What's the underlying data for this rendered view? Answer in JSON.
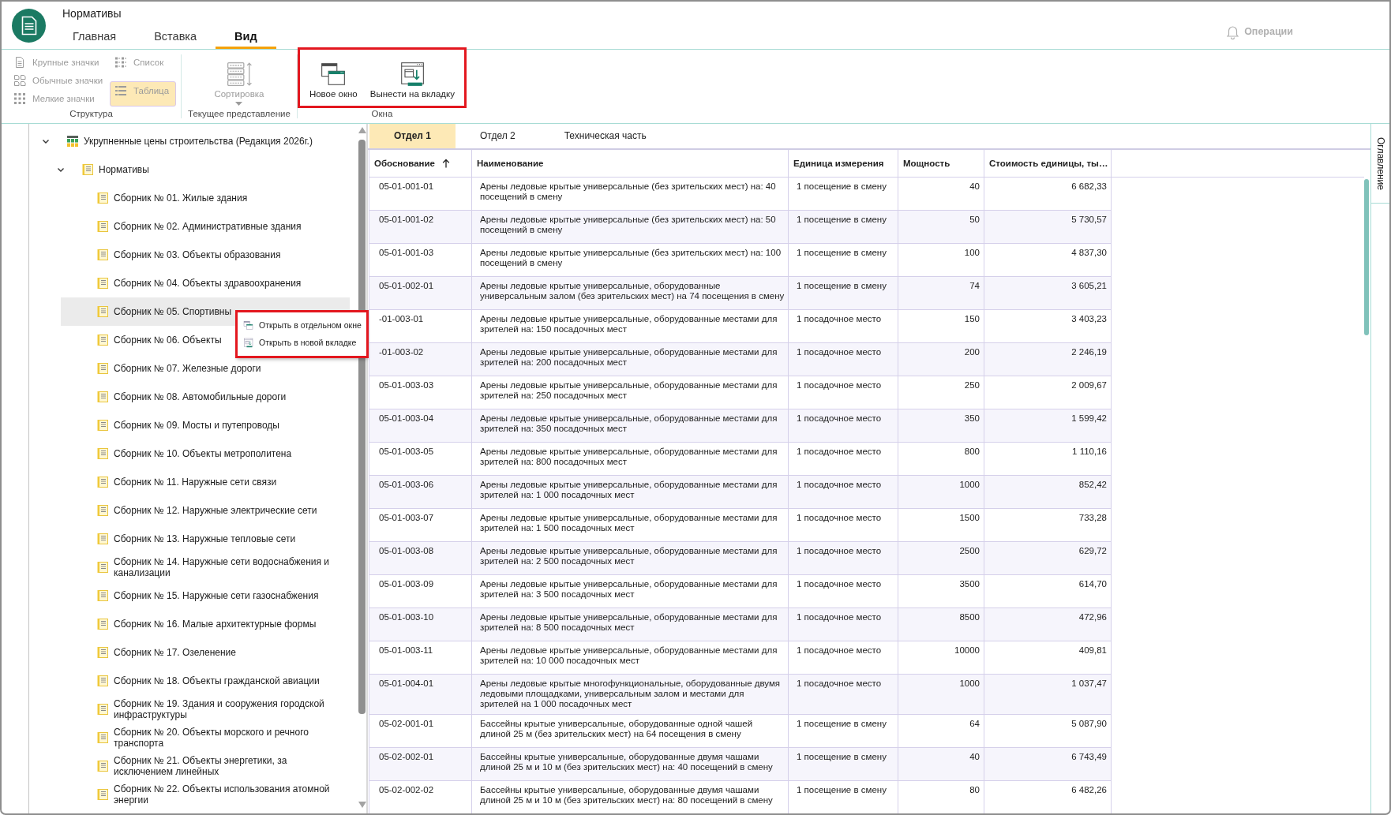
{
  "app": {
    "title": "Нормативы"
  },
  "ribbon_tabs": [
    {
      "label": "Главная",
      "selected": false
    },
    {
      "label": "Вставка",
      "selected": false
    },
    {
      "label": "Вид",
      "selected": true
    }
  ],
  "notifications": {
    "label": "Операции",
    "disabled": true
  },
  "ribbon": [
    {
      "label": "Структура",
      "kind": "small",
      "items": [
        {
          "label": "Крупные значки",
          "selected": false,
          "disabled": true
        },
        {
          "label": "Обычные значки",
          "selected": false,
          "disabled": true
        },
        {
          "label": "Мелкие значки",
          "selected": false,
          "disabled": true
        },
        {
          "label": "Список",
          "selected": false,
          "disabled": true
        },
        {
          "label": "Таблица",
          "selected": true,
          "disabled": true
        }
      ]
    },
    {
      "label": "Текущее представление",
      "kind": "large",
      "items": [
        {
          "label": "Сортировка",
          "disabled": true,
          "dropdown": true
        }
      ]
    },
    {
      "label": "Окна",
      "kind": "large",
      "highlighted": true,
      "items": [
        {
          "label": "Новое окно",
          "disabled": false
        },
        {
          "label": "Вынести на вкладку",
          "disabled": false
        }
      ]
    }
  ],
  "tree": {
    "items": [
      {
        "label": "Укрупненные цены строительства (Редакция 2026г.)",
        "expanded": true,
        "selected": false,
        "children": [
          {
            "label": "Нормативы",
            "expanded": true,
            "selected": false,
            "children": [
              {
                "label": "Сборник № 01. Жилые здания",
                "selected": false
              },
              {
                "label": "Сборник № 02. Административные здания",
                "selected": false
              },
              {
                "label": "Сборник № 03. Объекты образования",
                "selected": false
              },
              {
                "label": "Сборник № 04. Объекты здравоохранения",
                "selected": false
              },
              {
                "label": "Сборник № 05. Спортивны",
                "selected": true
              },
              {
                "label": "Сборник № 06. Объекты",
                "selected": false
              },
              {
                "label": "Сборник № 07. Железные дороги",
                "selected": false
              },
              {
                "label": "Сборник № 08. Автомобильные дороги",
                "selected": false
              },
              {
                "label": "Сборник № 09. Мосты и путепроводы",
                "selected": false
              },
              {
                "label": "Сборник № 10. Объекты метрополитена",
                "selected": false
              },
              {
                "label": "Сборник № 11. Наружные сети связи",
                "selected": false
              },
              {
                "label": "Сборник № 12. Наружные электрические сети",
                "selected": false
              },
              {
                "label": "Сборник № 13. Наружные тепловые сети",
                "selected": false
              },
              {
                "label": "Сборник № 14. Наружные сети водоснабжения и канализации",
                "selected": false
              },
              {
                "label": "Сборник № 15. Наружные сети газоснабжения",
                "selected": false
              },
              {
                "label": "Сборник № 16. Малые архитектурные формы",
                "selected": false
              },
              {
                "label": "Сборник № 17. Озеленение",
                "selected": false
              },
              {
                "label": "Сборник № 18. Объекты гражданской авиации",
                "selected": false
              },
              {
                "label": "Сборник № 19. Здания и сооружения городской инфраструктуры",
                "selected": false
              },
              {
                "label": "Сборник № 20. Объекты морского и речного транспорта",
                "selected": false
              },
              {
                "label": "Сборник № 21. Объекты энергетики, за исключением линейных",
                "selected": false
              },
              {
                "label": "Сборник № 22. Объекты использования атомной энергии",
                "selected": false
              }
            ]
          }
        ]
      }
    ]
  },
  "context_menu": {
    "highlighted": true,
    "items": [
      "Открыть в отдельном окне",
      "Открыть в новой вкладке"
    ]
  },
  "document_tabs": [
    {
      "label": "Отдел 1",
      "selected": true
    },
    {
      "label": "Отдел 2",
      "selected": false
    },
    {
      "label": "Техническая часть",
      "selected": false
    }
  ],
  "table": {
    "columns": [
      {
        "label": "Обоснование",
        "kind": "text",
        "sort_ascending": true
      },
      {
        "label": "Наименование",
        "kind": "text"
      },
      {
        "label": "Единица измерения",
        "kind": "text"
      },
      {
        "label": "Мощность",
        "kind": "number"
      },
      {
        "label": "Стоимость единицы, ты…",
        "kind": "number"
      }
    ],
    "rows": [
      [
        "05-01-001-01",
        "Арены ледовые крытые универсальные (без зрительских мест) на: 40 посещений в смену",
        "1 посещение в смену",
        "40",
        "6 682,33"
      ],
      [
        "05-01-001-02",
        "Арены ледовые крытые универсальные (без зрительских мест) на: 50 посещений в смену",
        "1 посещение в смену",
        "50",
        "5 730,57"
      ],
      [
        "05-01-001-03",
        "Арены ледовые крытые универсальные (без зрительских мест) на: 100 посещений в смену",
        "1 посещение в смену",
        "100",
        "4 837,30"
      ],
      [
        "05-01-002-01",
        "Арены ледовые крытые универсальные, оборудованные универсальным залом (без зрительских мест) на 74 посещения в смену",
        "1 посещение в смену",
        "74",
        "3 605,21"
      ],
      [
        "-01-003-01",
        "Арены ледовые крытые универсальные, оборудованные местами для зрителей на: 150 посадочных мест",
        "1 посадочное место",
        "150",
        "3 403,23"
      ],
      [
        "-01-003-02",
        "Арены ледовые крытые универсальные, оборудованные местами для зрителей на: 200 посадочных мест",
        "1 посадочное место",
        "200",
        "2 246,19"
      ],
      [
        "05-01-003-03",
        "Арены ледовые крытые универсальные, оборудованные местами для зрителей на: 250 посадочных мест",
        "1 посадочное место",
        "250",
        "2 009,67"
      ],
      [
        "05-01-003-04",
        "Арены ледовые крытые универсальные, оборудованные местами для зрителей на: 350 посадочных мест",
        "1 посадочное место",
        "350",
        "1 599,42"
      ],
      [
        "05-01-003-05",
        "Арены ледовые крытые универсальные, оборудованные местами для зрителей на: 800 посадочных мест",
        "1 посадочное место",
        "800",
        "1 110,16"
      ],
      [
        "05-01-003-06",
        "Арены ледовые крытые универсальные, оборудованные местами для зрителей на: 1 000 посадочных мест",
        "1 посадочное место",
        "1000",
        "852,42"
      ],
      [
        "05-01-003-07",
        "Арены ледовые крытые универсальные, оборудованные местами для зрителей на: 1 500 посадочных мест",
        "1 посадочное место",
        "1500",
        "733,28"
      ],
      [
        "05-01-003-08",
        "Арены ледовые крытые универсальные, оборудованные местами для зрителей на: 2 500 посадочных мест",
        "1 посадочное место",
        "2500",
        "629,72"
      ],
      [
        "05-01-003-09",
        "Арены ледовые крытые универсальные, оборудованные местами для зрителей на: 3 500 посадочных мест",
        "1 посадочное место",
        "3500",
        "614,70"
      ],
      [
        "05-01-003-10",
        "Арены ледовые крытые универсальные, оборудованные местами для зрителей на: 8 500 посадочных мест",
        "1 посадочное место",
        "8500",
        "472,96"
      ],
      [
        "05-01-003-11",
        "Арены ледовые крытые универсальные, оборудованные местами для зрителей на: 10 000 посадочных мест",
        "1 посадочное место",
        "10000",
        "409,81"
      ],
      [
        "05-01-004-01",
        "Арены ледовые крытые многофункциональные, оборудованные двумя ледовыми площадками, универсальным залом и местами для зрителей на 1 000 посадочных мест",
        "1 посадочное место",
        "1000",
        "1 037,47"
      ],
      [
        "05-02-001-01",
        "Бассейны крытые универсальные, оборудованные одной чашей длиной 25 м (без зрительских мест) на 64 посещения в смену",
        "1 посещение в смену",
        "64",
        "5 087,90"
      ],
      [
        "05-02-002-01",
        "Бассейны крытые универсальные, оборудованные двумя чашами длиной 25 м и 10 м (без зрительских мест) на: 40 посещений в смену",
        "1 посещение в смену",
        "40",
        "6 743,49"
      ],
      [
        "05-02-002-02",
        "Бассейны крытые универсальные, оборудованные двумя чашами длиной 25 м и 10 м (без зрительских мест) на: 80 посещений в смену",
        "1 посещение в смену",
        "80",
        "6 482,26"
      ]
    ]
  },
  "side_tab": {
    "label": "Оглавление"
  }
}
